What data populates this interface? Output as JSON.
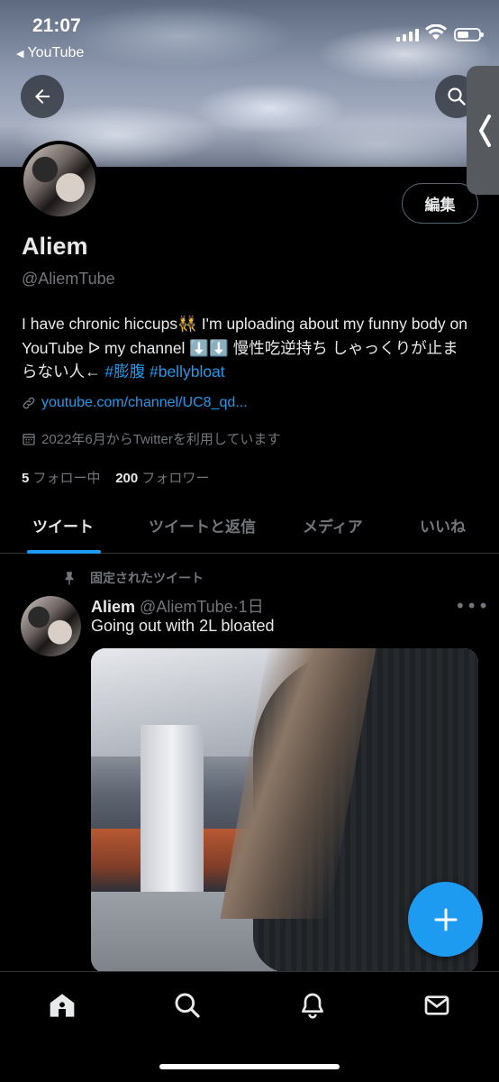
{
  "status_bar": {
    "time": "21:07",
    "back_app": "YouTube"
  },
  "header": {
    "back_icon": "arrow-left-icon",
    "search_icon": "search-icon"
  },
  "profile": {
    "edit_label": "編集",
    "name": "Aliem",
    "handle": "@AliemTube",
    "bio_text": "I have chronic hiccups👯 I'm uploading about my funny body on YouTube ᐅ my channel ⬇️⬇️ 慢性吃逆持ち しゃっくりが止まらない人← ",
    "bio_tag_1": "#膨腹",
    "bio_tag_2": "#bellybloat",
    "link": "youtube.com/channel/UC8_qd...",
    "joined": "2022年6月からTwitterを利用しています",
    "following_count": "5",
    "following_label": "フォロー中",
    "followers_count": "200",
    "followers_label": "フォロワー"
  },
  "tabs": [
    {
      "label": "ツイート",
      "active": true
    },
    {
      "label": "ツイートと返信",
      "active": false
    },
    {
      "label": "メディア",
      "active": false
    },
    {
      "label": "いいね",
      "active": false
    }
  ],
  "tweet": {
    "pinned_label": "固定されたツイート",
    "author_name": "Aliem",
    "author_handle": "@AliemTube",
    "time": "·1日",
    "more": "•••",
    "text": "Going out with 2L bloated"
  },
  "bottom_nav": [
    "home-icon",
    "search-icon",
    "bell-icon",
    "mail-icon"
  ],
  "colors": {
    "accent": "#1d9bf0",
    "background": "#000000",
    "text": "#e7e9ea",
    "secondary_text": "#71767b"
  }
}
